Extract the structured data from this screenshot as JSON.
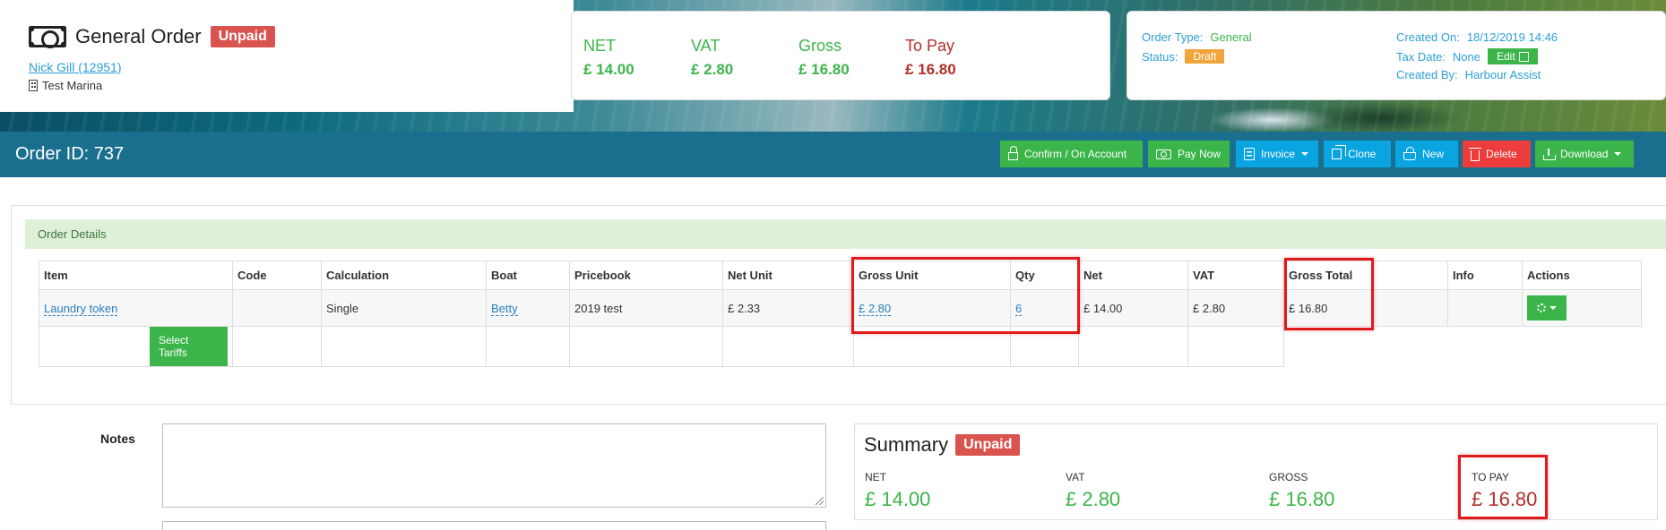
{
  "order": {
    "title": "General Order",
    "status_badge": "Unpaid",
    "customer": "Nick Gill (12951)",
    "marina": "Test Marina",
    "id_label": "Order ID: 737"
  },
  "totals": {
    "net_label": "NET",
    "net_value": "£ 14.00",
    "vat_label": "VAT",
    "vat_value": "£ 2.80",
    "gross_label": "Gross",
    "gross_value": "£ 16.80",
    "topay_label": "To Pay",
    "topay_value": "£ 16.80"
  },
  "info": {
    "order_type_label": "Order Type:",
    "order_type_value": "General",
    "status_label": "Status:",
    "status_value": "Draft",
    "created_on_label": "Created On:",
    "created_on_value": "18/12/2019 14:46",
    "tax_date_label": "Tax Date:",
    "tax_date_value": "None",
    "edit_label": "Edit",
    "created_by_label": "Created By:",
    "created_by_value": "Harbour Assist"
  },
  "toolbar": {
    "confirm": "Confirm / On Account",
    "pay_now": "Pay Now",
    "invoice": "Invoice",
    "clone": "Clone",
    "new": "New",
    "delete": "Delete",
    "download": "Download"
  },
  "details": {
    "header": "Order Details",
    "columns": [
      "Item",
      "Code",
      "Calculation",
      "Boat",
      "Pricebook",
      "Net Unit",
      "Gross Unit",
      "Qty",
      "Net",
      "VAT",
      "Gross Total",
      "Info",
      "Actions"
    ],
    "row": {
      "item": "Laundry token",
      "code": "",
      "calculation": "Single",
      "boat": "Betty",
      "pricebook": "2019 test",
      "net_unit": "£ 2.33",
      "gross_unit": "£ 2.80",
      "qty": "6",
      "net": "£ 14.00",
      "vat": "£ 2.80",
      "gross_total": "£ 16.80",
      "info": ""
    },
    "select_tariffs": "Select Tariffs"
  },
  "notes": {
    "label": "Notes"
  },
  "summary": {
    "title": "Summary",
    "badge": "Unpaid",
    "net_label": "NET",
    "net_value": "£ 14.00",
    "vat_label": "VAT",
    "vat_value": "£ 2.80",
    "gross_label": "GROSS",
    "gross_value": "£ 16.80",
    "topay_label": "TO PAY",
    "topay_value": "£ 16.80"
  },
  "colors": {
    "toolbar": "#1a6f8e",
    "green": "#3bb54a",
    "blue": "#0aa5e0",
    "red": "#ec3c3c",
    "highlight": "#e01a1a"
  },
  "icons": [
    "cash-icon",
    "building-icon",
    "edit-icon",
    "lock-icon",
    "money-icon",
    "invoice-icon",
    "clone-icon",
    "basket-icon",
    "trash-icon",
    "download-icon",
    "gear-icon"
  ]
}
